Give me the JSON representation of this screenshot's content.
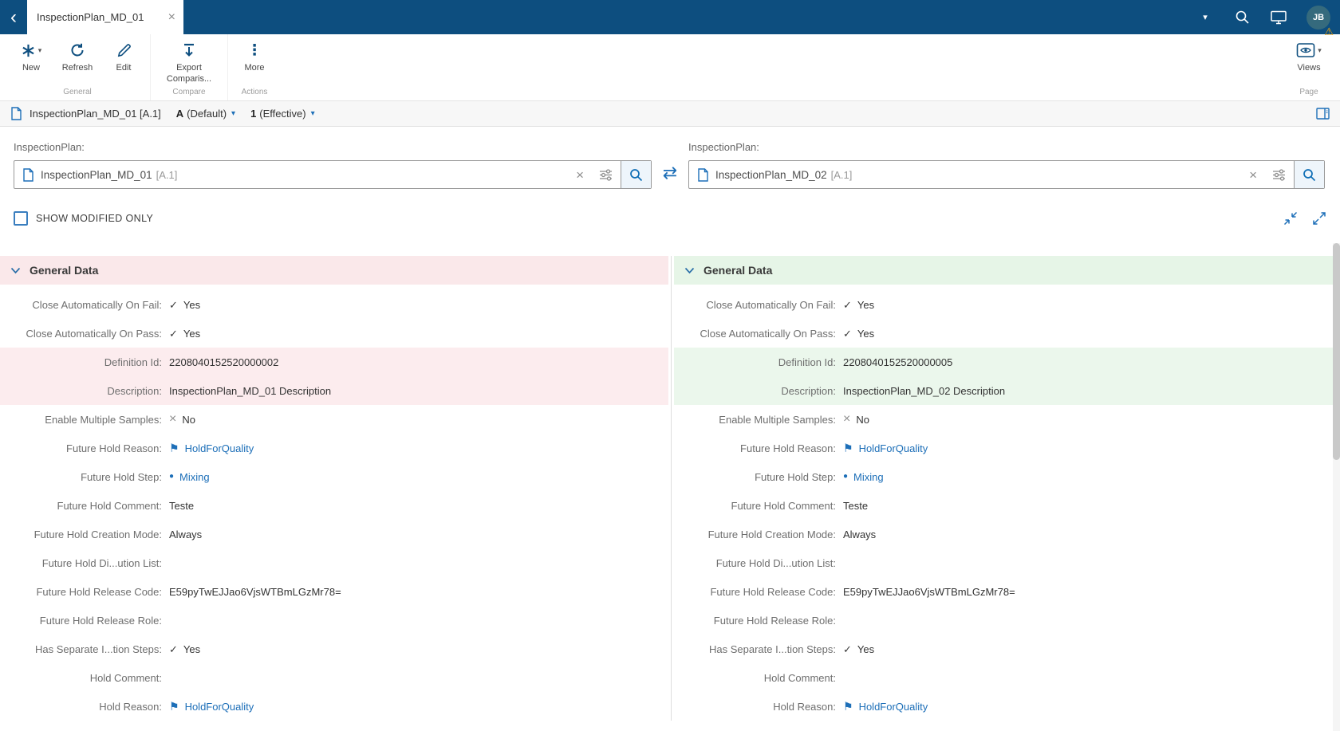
{
  "icons": {
    "back": "‹",
    "close": "×",
    "clear": "×",
    "dropdown": "▾",
    "more": "⋮",
    "swap": "⇄",
    "check": "✓",
    "cross": "×",
    "circle": "●",
    "flag": "⚑",
    "warning": "⚠"
  },
  "colors": {
    "topbar": "#0d4e7f",
    "accent_link": "#1d6fb8",
    "removed_header": "#fae8ea",
    "removed_row": "#fcecee",
    "added_header": "#e6f5e7",
    "added_row": "#ebf7ec"
  },
  "topbar": {
    "tab_title": "InspectionPlan_MD_01",
    "avatar_initials": "JB"
  },
  "toolbar": {
    "new_label": "New",
    "refresh_label": "Refresh",
    "edit_label": "Edit",
    "export_label": "Export Comparis...",
    "more_label": "More",
    "views_label": "Views",
    "groups": {
      "general": "General",
      "compare": "Compare",
      "actions": "Actions",
      "page": "Page"
    }
  },
  "breadcrumb": {
    "title": "InspectionPlan_MD_01 [A.1]",
    "version": "A",
    "version_qualifier": "(Default)",
    "revision": "1",
    "revision_qualifier": "(Effective)"
  },
  "compare": {
    "left_label": "InspectionPlan:",
    "left_value": "InspectionPlan_MD_01",
    "left_suffix": "[A.1]",
    "right_label": "InspectionPlan:",
    "right_value": "InspectionPlan_MD_02",
    "right_suffix": "[A.1]"
  },
  "filter": {
    "show_modified_only_label": "SHOW MODIFIED ONLY",
    "checked": false
  },
  "panels": [
    {
      "title": "General Data",
      "theme": "removed",
      "rows": [
        {
          "label": "Close Automatically On Fail:",
          "value": "Yes",
          "icon": "check"
        },
        {
          "label": "Close Automatically On Pass:",
          "value": "Yes",
          "icon": "check"
        },
        {
          "label": "Definition Id:",
          "value": "2208040152520000002",
          "highlight": true
        },
        {
          "label": "Description:",
          "value": "InspectionPlan_MD_01 Description",
          "highlight": true
        },
        {
          "label": "Enable Multiple Samples:",
          "value": "No",
          "icon": "cross"
        },
        {
          "label": "Future Hold Reason:",
          "value": "HoldForQuality",
          "icon": "flag",
          "link": true
        },
        {
          "label": "Future Hold Step:",
          "value": "Mixing",
          "icon": "circle",
          "link": true
        },
        {
          "label": "Future Hold Comment:",
          "value": "Teste"
        },
        {
          "label": "Future Hold Creation Mode:",
          "value": "Always"
        },
        {
          "label": "Future Hold Di...ution List:",
          "value": ""
        },
        {
          "label": "Future Hold Release Code:",
          "value": "E59pyTwEJJao6VjsWTBmLGzMr78="
        },
        {
          "label": "Future Hold Release Role:",
          "value": ""
        },
        {
          "label": "Has Separate I...tion Steps:",
          "value": "Yes",
          "icon": "check"
        },
        {
          "label": "Hold Comment:",
          "value": ""
        },
        {
          "label": "Hold Reason:",
          "value": "HoldForQuality",
          "icon": "flag",
          "link": true
        }
      ]
    },
    {
      "title": "General Data",
      "theme": "added",
      "rows": [
        {
          "label": "Close Automatically On Fail:",
          "value": "Yes",
          "icon": "check"
        },
        {
          "label": "Close Automatically On Pass:",
          "value": "Yes",
          "icon": "check"
        },
        {
          "label": "Definition Id:",
          "value": "2208040152520000005",
          "highlight": true
        },
        {
          "label": "Description:",
          "value": "InspectionPlan_MD_02 Description",
          "highlight": true
        },
        {
          "label": "Enable Multiple Samples:",
          "value": "No",
          "icon": "cross"
        },
        {
          "label": "Future Hold Reason:",
          "value": "HoldForQuality",
          "icon": "flag",
          "link": true
        },
        {
          "label": "Future Hold Step:",
          "value": "Mixing",
          "icon": "circle",
          "link": true
        },
        {
          "label": "Future Hold Comment:",
          "value": "Teste"
        },
        {
          "label": "Future Hold Creation Mode:",
          "value": "Always"
        },
        {
          "label": "Future Hold Di...ution List:",
          "value": ""
        },
        {
          "label": "Future Hold Release Code:",
          "value": "E59pyTwEJJao6VjsWTBmLGzMr78="
        },
        {
          "label": "Future Hold Release Role:",
          "value": ""
        },
        {
          "label": "Has Separate I...tion Steps:",
          "value": "Yes",
          "icon": "check"
        },
        {
          "label": "Hold Comment:",
          "value": ""
        },
        {
          "label": "Hold Reason:",
          "value": "HoldForQuality",
          "icon": "flag",
          "link": true
        }
      ]
    }
  ]
}
